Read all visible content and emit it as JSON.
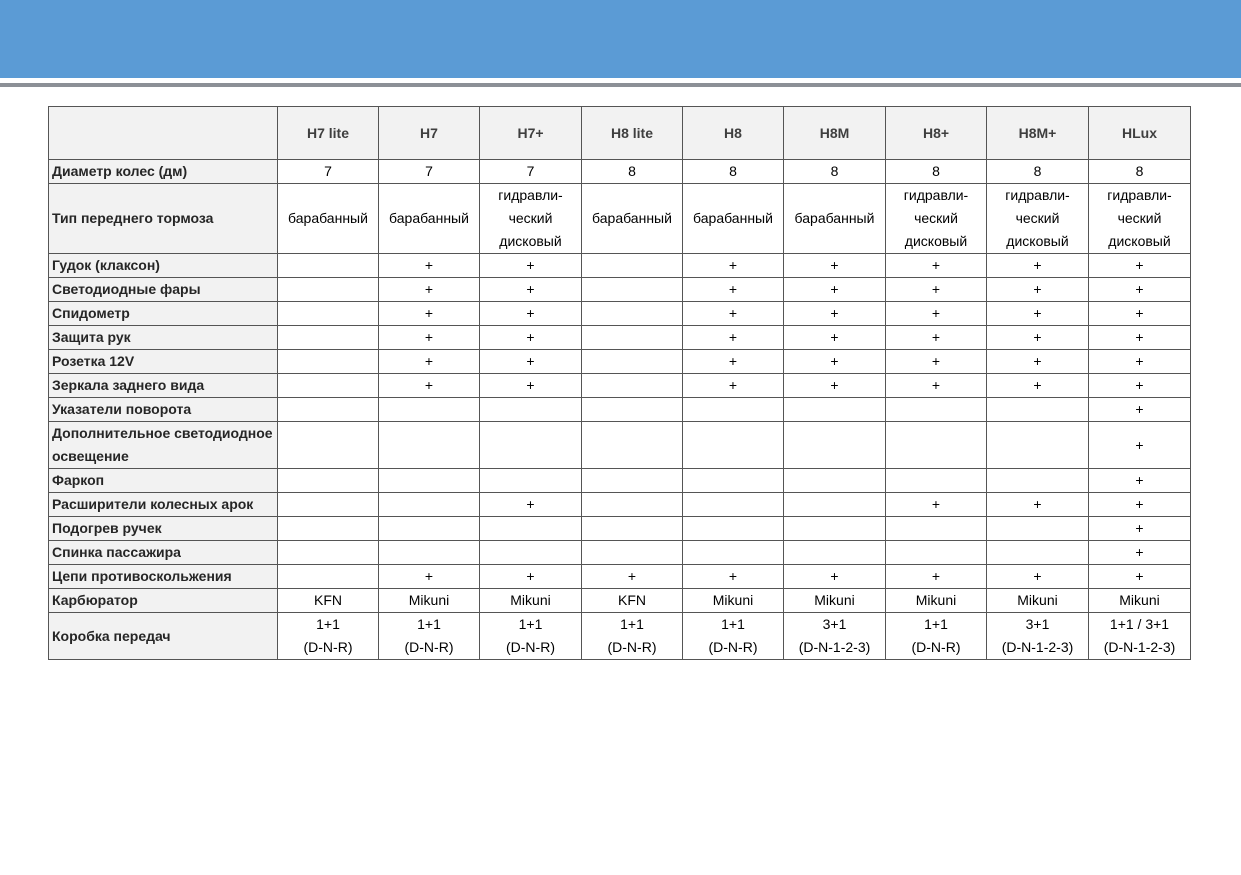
{
  "models": [
    "H7 lite",
    "H7",
    "H7+",
    "H8 lite",
    "H8",
    "H8M",
    "H8+",
    "H8M+",
    "HLux"
  ],
  "rows": [
    {
      "label": "Диаметр колес (дм)",
      "values": [
        "7",
        "7",
        "7",
        "8",
        "8",
        "8",
        "8",
        "8",
        "8"
      ]
    },
    {
      "label": "Тип переднего тормоза",
      "values": [
        "барабанный",
        "барабанный",
        "гидравли-\nческий\nдисковый",
        "барабанный",
        "барабанный",
        "барабанный",
        "гидравли-\nческий\nдисковый",
        "гидравли-\nческий\nдисковый",
        "гидравли-\nческий\nдисковый"
      ]
    },
    {
      "label": "Гудок (клаксон)",
      "values": [
        "",
        "+",
        "+",
        "",
        "+",
        "+",
        "+",
        "+",
        "+"
      ]
    },
    {
      "label": "Светодиодные фары",
      "values": [
        "",
        "+",
        "+",
        "",
        "+",
        "+",
        "+",
        "+",
        "+"
      ]
    },
    {
      "label": "Спидометр",
      "values": [
        "",
        "+",
        "+",
        "",
        "+",
        "+",
        "+",
        "+",
        "+"
      ]
    },
    {
      "label": "Защита рук",
      "values": [
        "",
        "+",
        "+",
        "",
        "+",
        "+",
        "+",
        "+",
        "+"
      ]
    },
    {
      "label": "Розетка 12V",
      "values": [
        "",
        "+",
        "+",
        "",
        "+",
        "+",
        "+",
        "+",
        "+"
      ]
    },
    {
      "label": "Зеркала заднего вида",
      "values": [
        "",
        "+",
        "+",
        "",
        "+",
        "+",
        "+",
        "+",
        "+"
      ]
    },
    {
      "label": "Указатели поворота",
      "values": [
        "",
        "",
        "",
        "",
        "",
        "",
        "",
        "",
        "+"
      ]
    },
    {
      "label": "Дополнительное светодиодное освещение",
      "values": [
        "",
        "",
        "",
        "",
        "",
        "",
        "",
        "",
        "+"
      ]
    },
    {
      "label": "Фаркоп",
      "values": [
        "",
        "",
        "",
        "",
        "",
        "",
        "",
        "",
        "+"
      ]
    },
    {
      "label": "Расширители колесных арок",
      "values": [
        "",
        "",
        "+",
        "",
        "",
        "",
        "+",
        "+",
        "+"
      ]
    },
    {
      "label": "Подогрев ручек",
      "values": [
        "",
        "",
        "",
        "",
        "",
        "",
        "",
        "",
        "+"
      ]
    },
    {
      "label": "Спинка пассажира",
      "values": [
        "",
        "",
        "",
        "",
        "",
        "",
        "",
        "",
        "+"
      ]
    },
    {
      "label": "Цепи противоскольжения",
      "values": [
        "",
        "+",
        "+",
        "+",
        "+",
        "+",
        "+",
        "+",
        "+"
      ]
    },
    {
      "label": "Карбюратор",
      "values": [
        "KFN",
        "Mikuni",
        "Mikuni",
        "KFN",
        "Mikuni",
        "Mikuni",
        "Mikuni",
        "Mikuni",
        "Mikuni"
      ]
    },
    {
      "label": "Коробка передач",
      "values": [
        "1+1\n(D-N-R)",
        "1+1\n(D-N-R)",
        "1+1\n(D-N-R)",
        "1+1\n(D-N-R)",
        "1+1\n(D-N-R)",
        "3+1\n(D-N-1-2-3)",
        "1+1\n(D-N-R)",
        "3+1\n(D-N-1-2-3)",
        "1+1 / 3+1\n(D-N-1-2-3)"
      ]
    }
  ]
}
